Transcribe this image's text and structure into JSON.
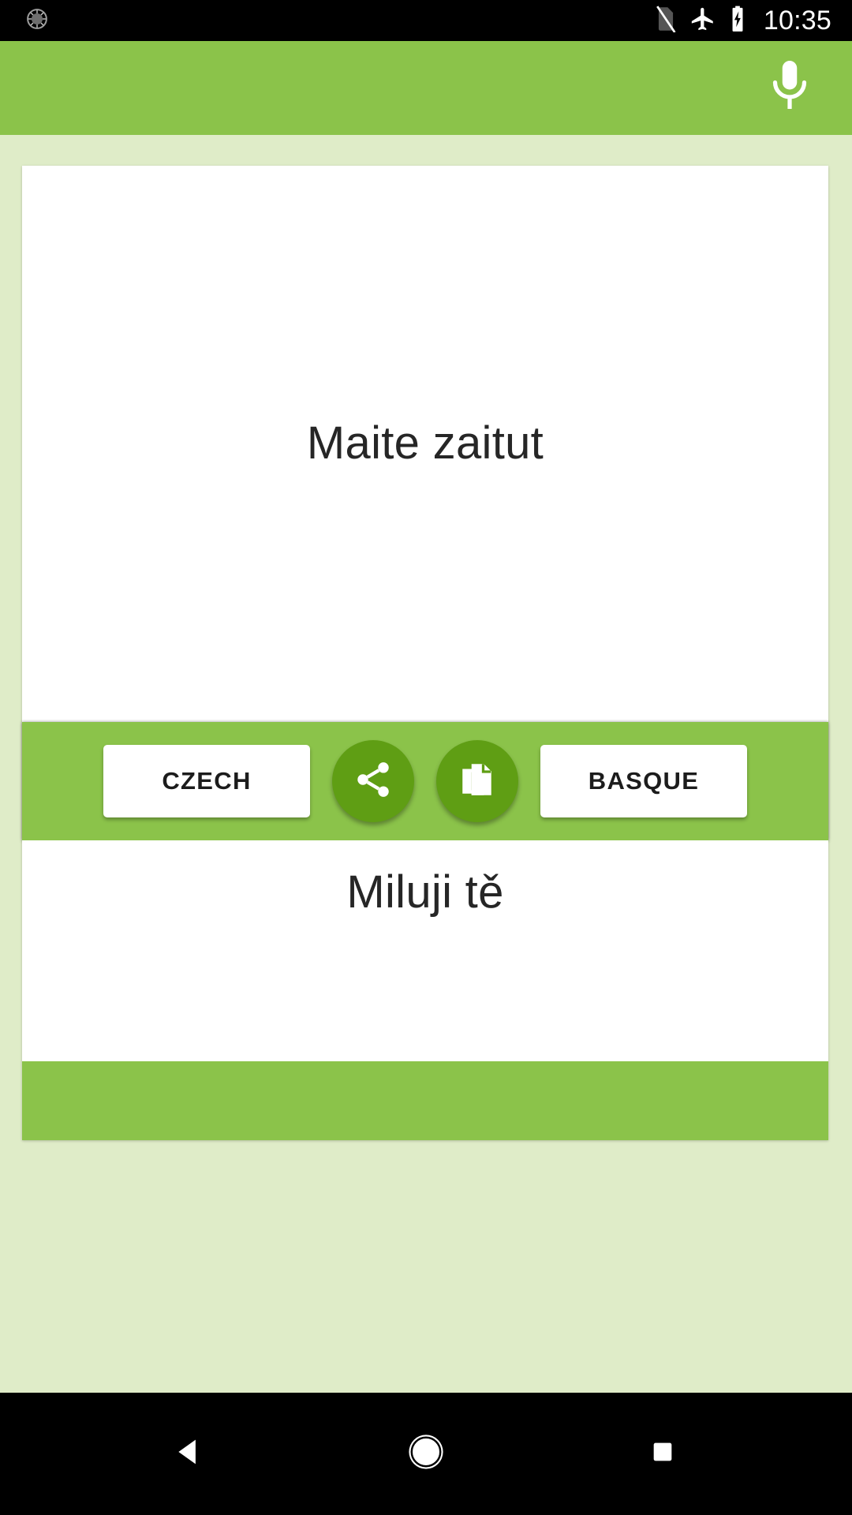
{
  "status_bar": {
    "notification_icon": "brightness-notification-icon",
    "icons": [
      "no-sim-icon",
      "airplane-mode-icon",
      "battery-charging-icon"
    ],
    "clock": "10:35",
    "background_color": "#000000",
    "foreground_color": "#ffffff"
  },
  "toolbar": {
    "mic_icon": "microphone-icon",
    "background_color": "#8bc34a"
  },
  "card": {
    "source": {
      "text": "Maite zaitut"
    },
    "controls": {
      "source_language_label": "CZECH",
      "share_icon": "share-icon",
      "copy_icon": "copy-icon",
      "target_language_label": "BASQUE",
      "bar_color": "#8bc34a",
      "round_button_color": "#5f9e14"
    },
    "target": {
      "text": "Miluji tě"
    }
  },
  "nav_bar": {
    "back_label": "back-button",
    "home_label": "home-button",
    "recents_label": "recents-button",
    "background_color": "#000000"
  },
  "theme": {
    "accent": "#8bc34a",
    "accent_dark": "#5f9e14",
    "page_background": "#dfecc8",
    "card_background": "#ffffff",
    "text_color": "#262626"
  }
}
